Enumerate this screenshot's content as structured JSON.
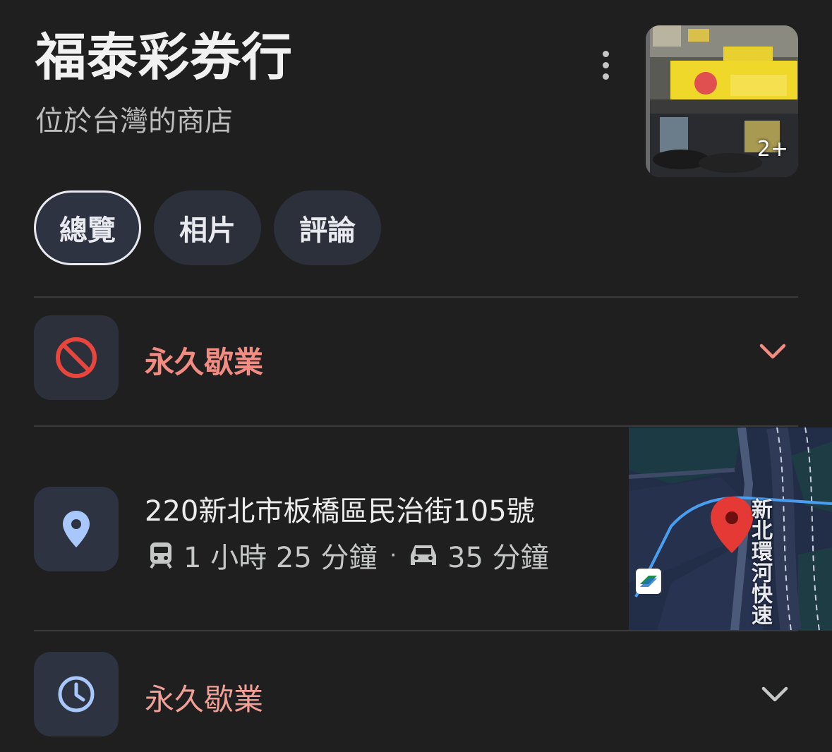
{
  "place": {
    "name": "福泰彩券行",
    "subtitle": "位於台灣的商店",
    "photo_count": "2+"
  },
  "tabs": [
    {
      "label": "總覽",
      "active": true
    },
    {
      "label": "相片",
      "active": false
    },
    {
      "label": "評論",
      "active": false
    }
  ],
  "status": {
    "text": "永久歇業",
    "icon": "no-entry-icon",
    "color": "#f28b82"
  },
  "address": {
    "text": "220新北市板橋區民治街105號",
    "transit_time": "1 小時 25 分鐘",
    "separator": "·",
    "drive_time": "35 分鐘",
    "map_road_label": "新北環河快速"
  },
  "hours": {
    "text": "永久歇業",
    "icon": "clock-icon"
  },
  "colors": {
    "background": "#1f1f1f",
    "accent_blue": "#a8c7fa",
    "closed_red": "#f28b82",
    "pin_red": "#e53935"
  }
}
